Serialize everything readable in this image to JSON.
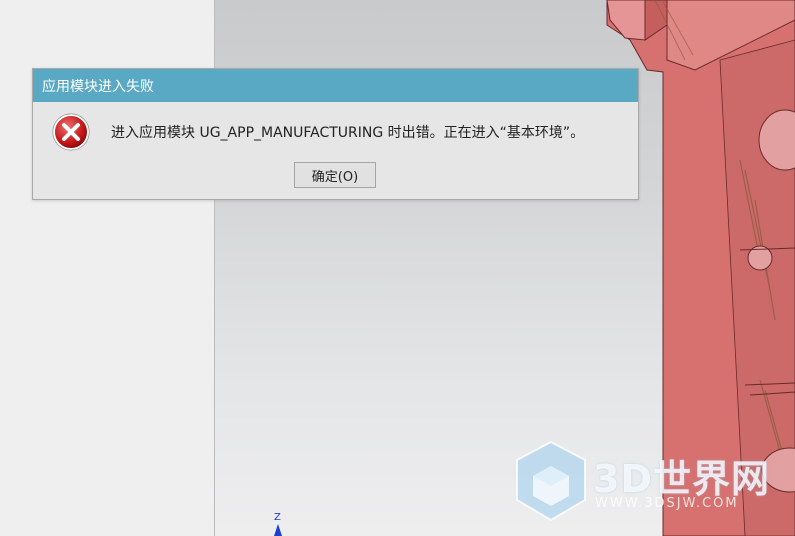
{
  "dialog": {
    "title": "应用模块进入失败",
    "message": "进入应用模块 UG_APP_MANUFACTURING 时出错。正在进入“基本环境”。",
    "ok_label": "确定(O)",
    "icon": "error-icon"
  },
  "viewport": {
    "axis_label": "Z",
    "model_color": "#d8706e"
  },
  "watermark": {
    "title": "3D世界网",
    "url": "WWW.3DSJW.COM"
  }
}
